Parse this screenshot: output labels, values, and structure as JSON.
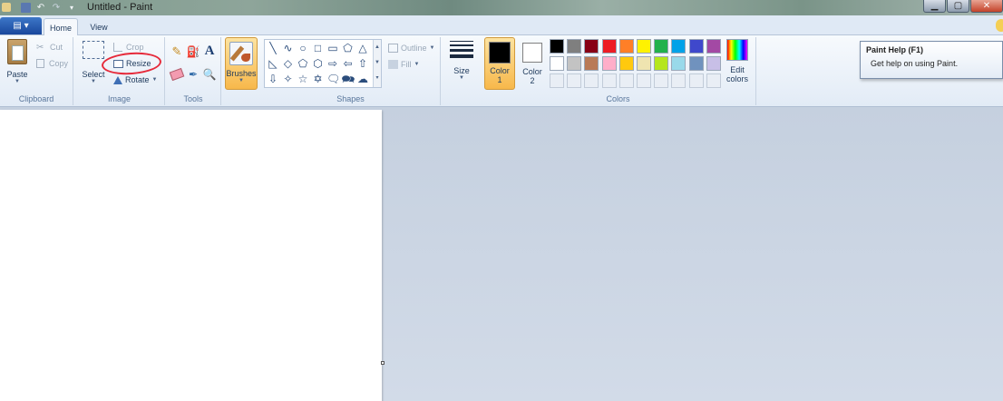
{
  "window": {
    "title": "Untitled - Paint",
    "min_glyph": "▁",
    "max_glyph": "▢",
    "close_glyph": "✕"
  },
  "tabs": {
    "home": "Home",
    "view": "View"
  },
  "app_menu_glyph": "▤ ▾",
  "clipboard": {
    "paste": "Paste",
    "cut": "Cut",
    "copy": "Copy",
    "label": "Clipboard"
  },
  "image": {
    "select": "Select",
    "crop": "Crop",
    "resize": "Resize",
    "rotate": "Rotate",
    "label": "Image"
  },
  "tools": {
    "label": "Tools",
    "text_glyph": "A"
  },
  "brushes": {
    "label": "Brushes"
  },
  "shapes": {
    "outline": "Outline",
    "fill": "Fill",
    "label": "Shapes",
    "glyphs": [
      "╲",
      "∿",
      "○",
      "□",
      "▭",
      "⬠",
      "△",
      "◺",
      "◇",
      "⬠",
      "⬡",
      "⇨",
      "⇦",
      "⇧",
      "⇩",
      "✧",
      "☆",
      "✡",
      "🗨",
      "🗪",
      "☁"
    ]
  },
  "size": {
    "label": "Size"
  },
  "colors": {
    "label": "Colors",
    "color1_line1": "Color",
    "color1_line2": "1",
    "color2_line1": "Color",
    "color2_line2": "2",
    "edit_line1": "Edit",
    "edit_line2": "colors",
    "color1_value": "#000000",
    "color2_value": "#ffffff",
    "row1": [
      "#000000",
      "#7f7f7f",
      "#880015",
      "#ed1c24",
      "#ff7f27",
      "#fff200",
      "#22b14c",
      "#00a2e8",
      "#3f48cc",
      "#a349a4"
    ],
    "row2": [
      "#ffffff",
      "#c3c3c3",
      "#b97a57",
      "#ffaec9",
      "#ffc90e",
      "#efe4b0",
      "#b5e61d",
      "#99d9ea",
      "#7092be",
      "#c8bfe7"
    ]
  },
  "tooltip": {
    "title": "Paint Help (F1)",
    "body": "Get help on using Paint."
  }
}
